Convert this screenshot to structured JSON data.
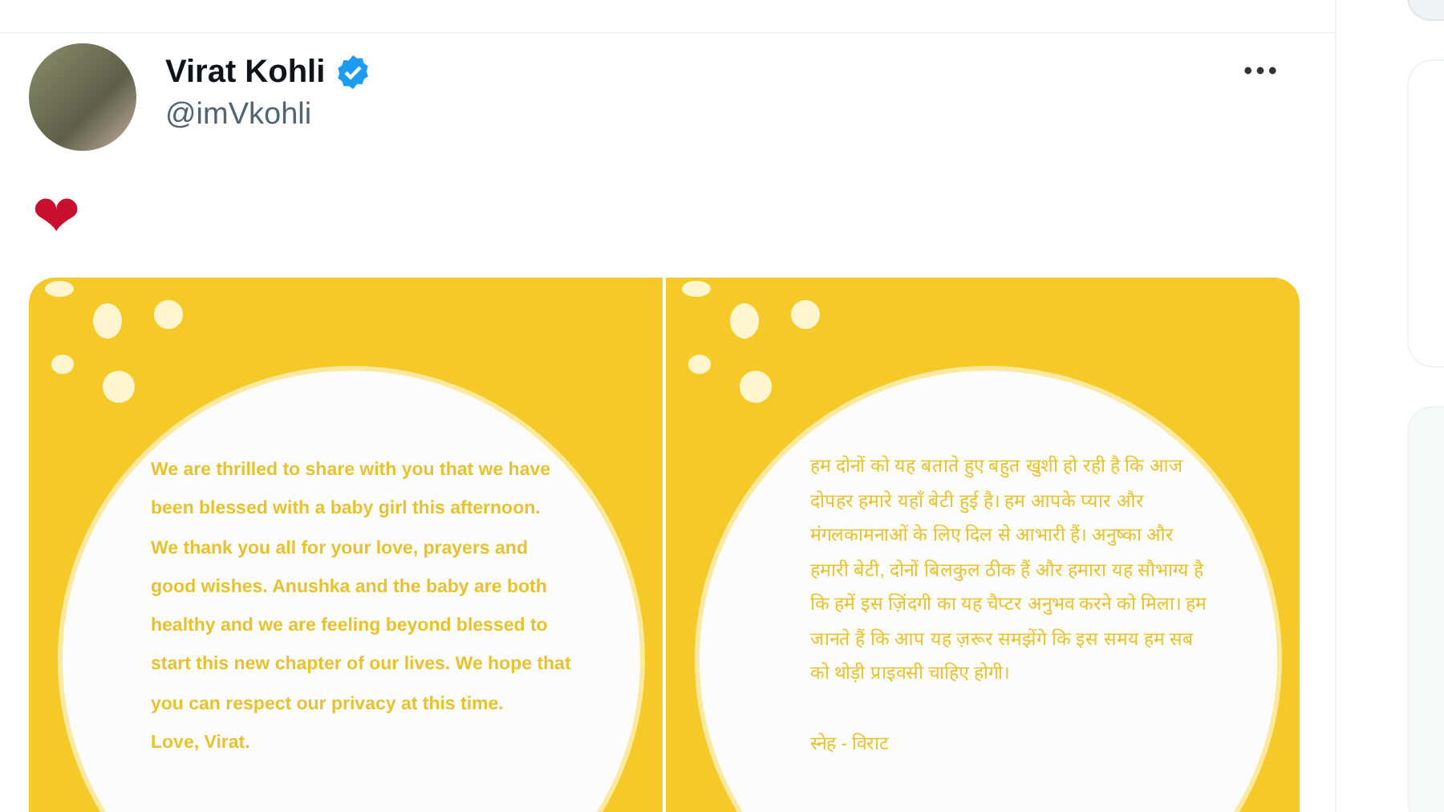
{
  "post": {
    "author": {
      "name": "Virat Kohli",
      "verified": true,
      "handle": "@imVkohli"
    },
    "text": "❤",
    "images": [
      {
        "kind": "note",
        "paragraph": "We are thrilled to share with you that we have been blessed with a baby girl this afternoon. We thank you all for your love, prayers and good wishes. Anushka and the baby are both healthy and we are feeling beyond blessed to start this new chapter of our lives. We hope that you can respect our privacy at this time.",
        "signature": "Love, Virat."
      },
      {
        "kind": "note",
        "paragraph": "हम दोनों को यह बताते हुए बहुत खुशी हो रही है कि आज दोपहर हमारे यहाँ बेटी हुई है। हम आपके प्यार और मंगलकामनाओं के लिए दिल से आभारी हैं। अनुष्का और हमारी बेटी, दोनों बिलकुल ठीक हैं और हमारा यह सौभाग्य है कि हमें इस ज़िंदगी का यह चैप्टर अनुभव करने को मिला। हम जानते हैं कि आप यह ज़रूर समझेंगे कि इस समय हम सब को थोड़ी प्राइवसी चाहिए होगी।",
        "signature": "स्नेह - विराट"
      }
    ]
  }
}
